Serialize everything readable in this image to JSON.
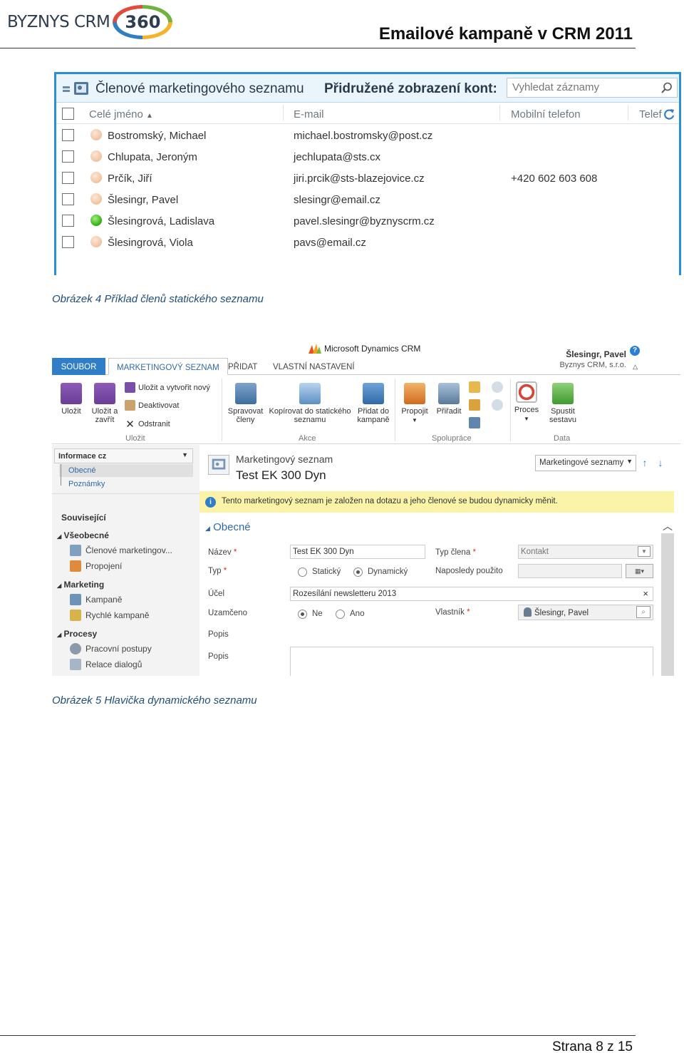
{
  "header": {
    "logo_text": "BYZNYS CRM",
    "logo_number": "360",
    "doc_title": "Emailové kampaně v CRM 2011"
  },
  "figure4": {
    "title": "Členové marketingového seznamu",
    "subtitle": "Přidružené zobrazení kont:",
    "search_placeholder": "Vyhledat záznamy",
    "columns": {
      "name": "Celé jméno",
      "email": "E-mail",
      "phone": "Mobilní telefon",
      "extra": "Telef"
    },
    "rows": [
      {
        "name": "Bostromský, Michael",
        "email": "michael.bostromsky@post.cz",
        "phone": "",
        "status": "offline"
      },
      {
        "name": "Chlupata, Jeroným",
        "email": "jechlupata@sts.cx",
        "phone": "",
        "status": "offline"
      },
      {
        "name": "Prčík, Jiří",
        "email": "jiri.prcik@sts-blazejovice.cz",
        "phone": "+420 602 603 608",
        "status": "offline"
      },
      {
        "name": "Šlesingr, Pavel",
        "email": "slesingr@email.cz",
        "phone": "",
        "status": "offline"
      },
      {
        "name": "Šlesingrová, Ladislava",
        "email": "pavel.slesingr@byznyscrm.cz",
        "phone": "",
        "status": "online"
      },
      {
        "name": "Šlesingrová, Viola",
        "email": "pavs@email.cz",
        "phone": "",
        "status": "offline"
      }
    ],
    "caption": "Obrázek 4 Příklad členů statického seznamu"
  },
  "figure5": {
    "brand": "Microsoft Dynamics CRM",
    "user": {
      "name": "Šlesingr, Pavel",
      "org": "Byznys CRM, s.r.o."
    },
    "tabs": [
      "SOUBOR",
      "MARKETINGOVÝ SEZNAM",
      "PŘIDAT",
      "VLASTNÍ NASTAVENÍ"
    ],
    "ribbon": {
      "save": "Uložit",
      "save_close": "Uložit a zavřít",
      "save_new": "Uložit a vytvořit nový",
      "deactivate": "Deaktivovat",
      "delete": "Odstranit",
      "group_save": "Uložit",
      "manage_members": "Spravovat členy",
      "copy_static": "Kopírovat do statického seznamu",
      "add_campaign": "Přidat do kampaně",
      "group_action": "Akce",
      "connect": "Propojit",
      "assign": "Přiřadit",
      "group_collab": "Spolupráce",
      "process": "Proces",
      "run_report": "Spustit sestavu",
      "group_data": "Data"
    },
    "nav": {
      "selector": "Informace cz",
      "items": [
        "Obecné",
        "Poznámky"
      ],
      "related": "Související",
      "general_head": "Všeobecné",
      "general_items": [
        "Členové marketingov...",
        "Propojení"
      ],
      "marketing_head": "Marketing",
      "marketing_items": [
        "Kampaně",
        "Rychlé kampaně"
      ],
      "processes_head": "Procesy",
      "processes_items": [
        "Pracovní postupy",
        "Relace dialogů"
      ]
    },
    "form": {
      "entity": "Marketingový seznam",
      "name": "Test EK 300 Dyn",
      "view": "Marketingové seznamy",
      "notice": "Tento marketingový seznam je založen na dotazu a jeho členové se budou dynamicky měnit.",
      "section": "Obecné",
      "labels": {
        "name": "Název",
        "type": "Typ",
        "purpose": "Účel",
        "locked": "Uzamčeno",
        "description_head": "Popis",
        "description": "Popis",
        "member_type": "Typ člena",
        "last_used": "Naposledy použito",
        "owner": "Vlastník"
      },
      "values": {
        "name": "Test EK 300 Dyn",
        "member_type": "Kontakt",
        "purpose": "Rozesílání newsletteru 2013",
        "owner": "Šlesingr, Pavel"
      },
      "options": {
        "static": "Statický",
        "dynamic": "Dynamický",
        "no": "Ne",
        "yes": "Ano"
      },
      "required_mark": "*",
      "clear_mark": "×"
    },
    "caption": "Obrázek 5 Hlavička dynamického seznamu"
  },
  "footer": {
    "page": "Strana 8 z 15"
  }
}
